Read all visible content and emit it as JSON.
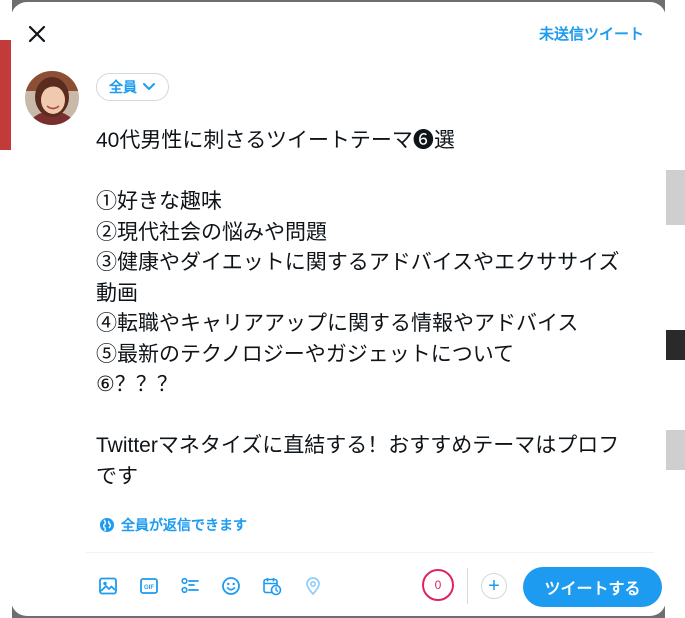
{
  "header": {
    "close_icon": "close-icon",
    "drafts_label": "未送信ツイート"
  },
  "audience": {
    "label": "全員"
  },
  "compose": {
    "lines": [
      "40代男性に刺さるツイートテーマ❻選",
      "",
      "①好きな趣味",
      "②現代社会の悩みや問題",
      "③健康やダイエットに関するアドバイスやエクササイズ",
      "動画",
      "④転職やキャリアアップに関する情報やアドバイス",
      "⑤最新のテクノロジーやガジェットについて",
      "⑥？？？",
      "",
      "Twitterマネタイズに直結する！おすすめテーマはプロフ",
      "です"
    ]
  },
  "reply_setting": {
    "label": "全員が返信できます",
    "icon": "globe-icon"
  },
  "toolbar": {
    "icons": [
      "media-icon",
      "gif-icon",
      "poll-icon",
      "emoji-icon",
      "schedule-icon",
      "location-icon"
    ],
    "char_counter": "0",
    "add_icon": "+",
    "tweet_label": "ツイートする"
  },
  "colors": {
    "accent": "#1d9bf0",
    "counter": "#e0245e",
    "text": "#0f1419"
  }
}
